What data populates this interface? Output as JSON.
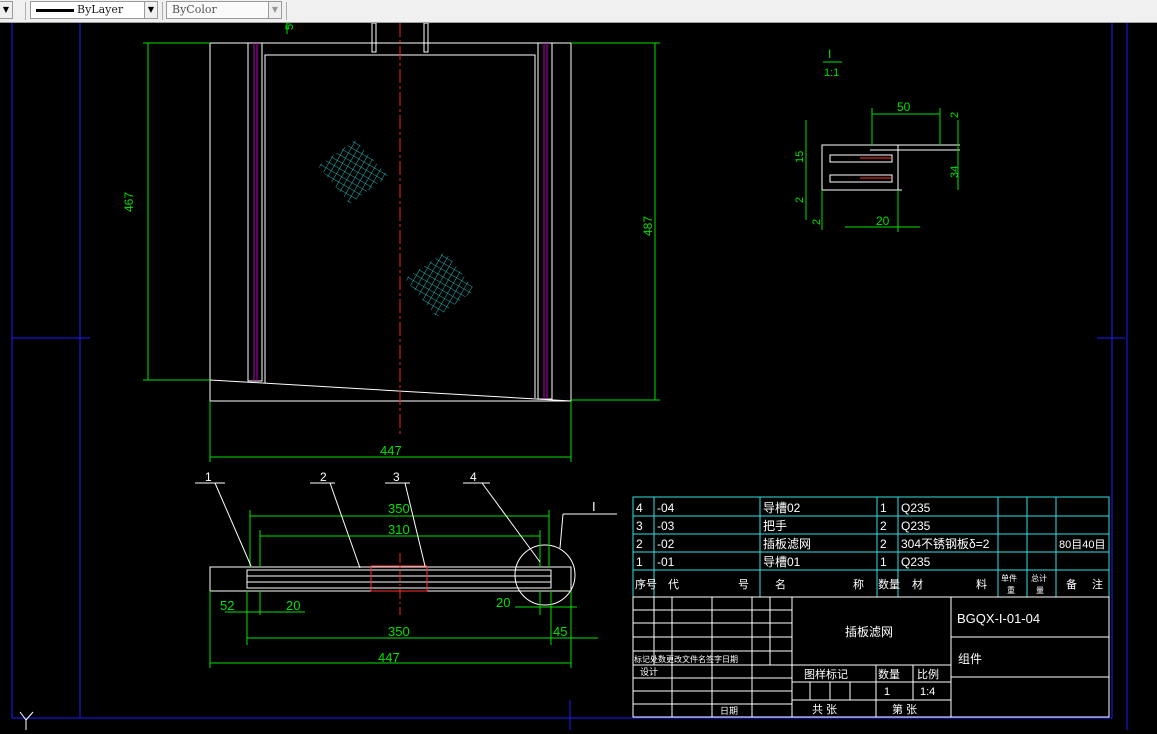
{
  "toolbar": {
    "linetype_value": "ByLayer",
    "color_value": "ByColor"
  },
  "drawing": {
    "dims": {
      "top_50": "50",
      "h_467": "467",
      "h_487": "487",
      "w_447_top": "447",
      "detail_scale_label": "I",
      "detail_scale": "1:1",
      "d50": "50",
      "d2a": "2",
      "d15": "15",
      "d34": "34",
      "d2b": "2",
      "d2c": "2",
      "d20": "20",
      "b350_top": "350",
      "b310": "310",
      "b52": "52",
      "b20a": "20",
      "b20b": "20",
      "b350_bot": "350",
      "b45": "45",
      "b447": "447",
      "callout_1": "1",
      "callout_2": "2",
      "callout_3": "3",
      "callout_4": "4",
      "callout_I": "I"
    },
    "bom": {
      "rows": [
        {
          "no": "4",
          "code": "-04",
          "name": "导槽02",
          "qty": "1",
          "material": "Q235",
          "unit_wt": "",
          "total_wt": "",
          "note": ""
        },
        {
          "no": "3",
          "code": "-03",
          "name": "把手",
          "qty": "2",
          "material": "Q235",
          "unit_wt": "",
          "total_wt": "",
          "note": ""
        },
        {
          "no": "2",
          "code": "-02",
          "name": "插板滤网",
          "qty": "2",
          "material": "304不锈钢板δ=2",
          "unit_wt": "",
          "total_wt": "",
          "note": "80目40目"
        },
        {
          "no": "1",
          "code": "-01",
          "name": "导槽01",
          "qty": "1",
          "material": "Q235",
          "unit_wt": "",
          "total_wt": "",
          "note": ""
        }
      ],
      "header": {
        "no": "序号",
        "code_a": "代",
        "code_b": "号",
        "name_a": "名",
        "name_b": "称",
        "qty": "数量",
        "mat_a": "材",
        "mat_b": "料",
        "unit_top": "单件",
        "unit_bot": "重",
        "total_top": "总计",
        "total_bot": "量",
        "note_a": "备",
        "note_b": "注"
      }
    },
    "title_block": {
      "part_name": "插板滤网",
      "drawing_no": "BGQX-I-01-04",
      "kind": "组件",
      "rev_header": "标记处数更改文件名签字日期",
      "design_label": "设计",
      "date_label": "日期",
      "stage_label": "图样标记",
      "weight_label": "数量",
      "scale_label": "比例",
      "qty_value": "1",
      "scale_value": "1:4",
      "total_sheets": "共   张",
      "sheet_no": "第   张"
    }
  }
}
